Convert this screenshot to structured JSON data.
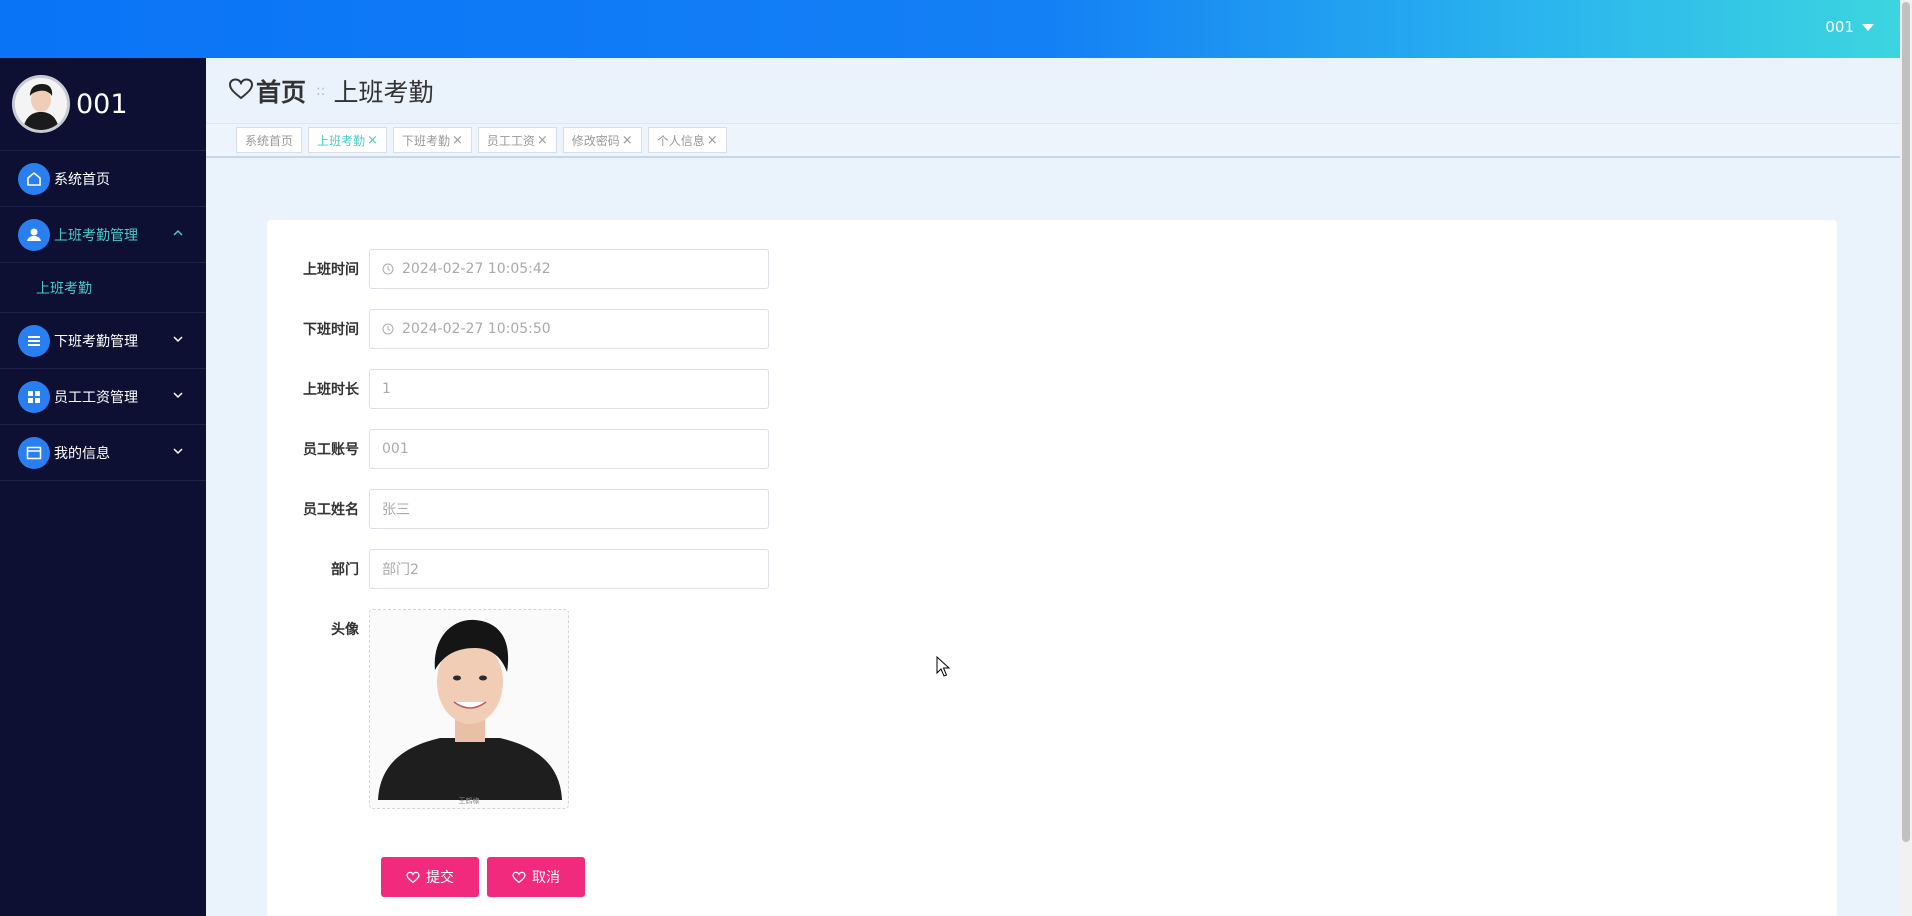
{
  "header": {
    "username": "001",
    "gradient_colors": [
      "#0a74f7",
      "#2ab4ee",
      "#3dd6df"
    ]
  },
  "sidebar": {
    "username": "001",
    "items": [
      {
        "label": "系统首页",
        "icon": "home-icon"
      },
      {
        "label": "上班考勤管理",
        "icon": "user-icon",
        "expanded": true,
        "active": true
      },
      {
        "label": "下班考勤管理",
        "icon": "list-icon"
      },
      {
        "label": "员工工资管理",
        "icon": "grid-icon"
      },
      {
        "label": "我的信息",
        "icon": "card-icon"
      }
    ],
    "submenu": [
      {
        "label": "上班考勤"
      }
    ],
    "accent_color": "#4ec9c6",
    "background_color": "#0d1033"
  },
  "breadcrumb": {
    "home": "首页",
    "separator": "::",
    "current": "上班考勤"
  },
  "tabs": [
    {
      "label": "系统首页",
      "closable": false
    },
    {
      "label": "上班考勤",
      "closable": true,
      "active": true
    },
    {
      "label": "下班考勤",
      "closable": true
    },
    {
      "label": "员工工资",
      "closable": true
    },
    {
      "label": "修改密码",
      "closable": true
    },
    {
      "label": "个人信息",
      "closable": true
    }
  ],
  "tab_close_symbol": "×",
  "form": {
    "fields": [
      {
        "label": "上班时间",
        "value": "2024-02-27 10:05:42",
        "icon": "clock-icon"
      },
      {
        "label": "下班时间",
        "value": "2024-02-27 10:05:50",
        "icon": "clock-icon"
      },
      {
        "label": "上班时长",
        "value": "1"
      },
      {
        "label": "员工账号",
        "value": "001"
      },
      {
        "label": "员工姓名",
        "value": "张三"
      },
      {
        "label": "部门",
        "value": "部门2"
      }
    ],
    "avatar_label": "头像",
    "avatar_caption": "王鹤棣"
  },
  "buttons": {
    "submit": "提交",
    "cancel": "取消",
    "color": "#f22a7d"
  }
}
